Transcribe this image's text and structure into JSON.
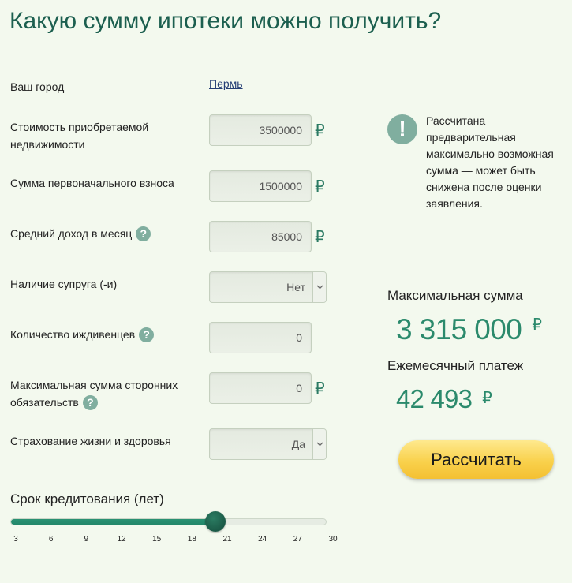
{
  "page": {
    "title": "Какую сумму ипотеки можно получить?"
  },
  "currency": "₽",
  "icons": {
    "help": "?",
    "alert": "!",
    "help_icon": "question-circle-icon",
    "alert_icon": "exclamation-circle-icon",
    "dropdown_icon": "chevron-down-icon"
  },
  "colors": {
    "background": "#f3f9ee",
    "title": "#1c5f4f",
    "accent": "#2b8a6c",
    "icon": "#80ae9f",
    "link": "#253f75",
    "slider_fill": "#23876a",
    "slider_thumb": "#1b5a47",
    "button": "#f9d14c"
  },
  "form": {
    "city": {
      "label": "Ваш город",
      "value": "Пермь"
    },
    "property_price": {
      "label": "Стоимость приобретаемой недвижимости",
      "value": "3500000"
    },
    "down_payment": {
      "label": "Сумма первоначального взноса",
      "value": "1500000"
    },
    "monthly_income": {
      "label": "Средний доход в месяц",
      "value": "85000"
    },
    "spouse": {
      "label": "Наличие супруга (-и)",
      "value": "Нет"
    },
    "dependents": {
      "label": "Количество иждивенцев",
      "value": "0"
    },
    "other_obligations": {
      "label": "Максимальная сумма сторонних обязательств",
      "value": "0"
    },
    "life_insurance": {
      "label": "Страхование жизни и здоровья",
      "value": "Да"
    }
  },
  "loan_term": {
    "label": "Срок кредитования (лет)",
    "min": 3,
    "max": 30,
    "value": 20,
    "ticks": [
      3,
      6,
      9,
      12,
      15,
      18,
      21,
      24,
      27,
      30
    ]
  },
  "info": {
    "text": "Рассчитана предварительная максимально возможная сумма — может быть снижена после оценки заявления."
  },
  "results": {
    "max_amount": {
      "label": "Максимальная сумма",
      "value": "3 315 000"
    },
    "monthly_payment": {
      "label": "Ежемесячный платеж",
      "value": "42 493"
    }
  },
  "button": {
    "label": "Рассчитать"
  }
}
